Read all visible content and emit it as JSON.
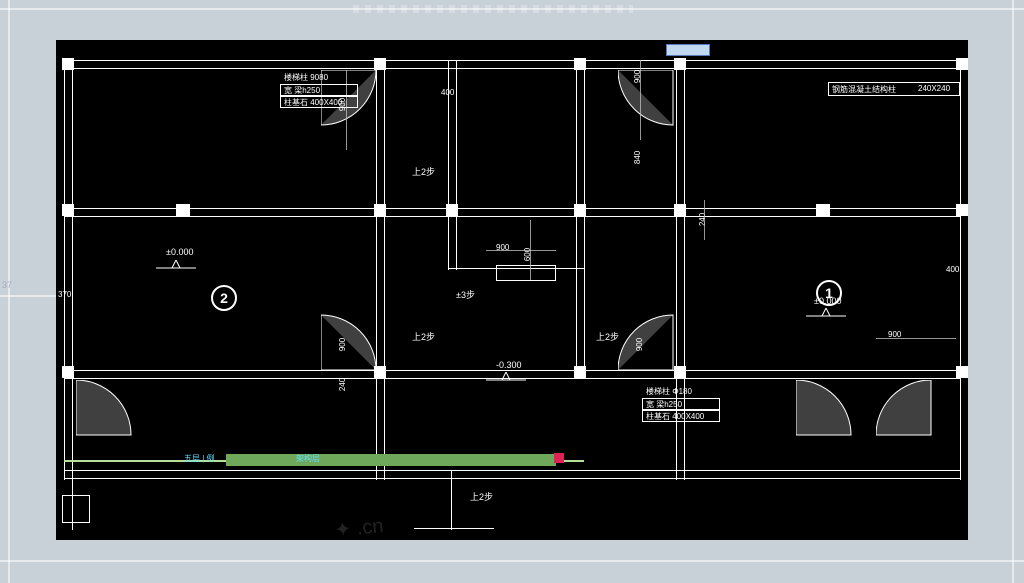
{
  "drawing": {
    "room_markers": {
      "left": "2",
      "right": "1"
    },
    "elevations": {
      "zero_left": "±0.000",
      "zero_right": "±0.000",
      "neg": "-0.300",
      "stair_a": "±3步",
      "stair_b": "上2步",
      "stair_c": "上2步",
      "stair_d": "上2步",
      "stair_e": "上2步"
    },
    "dimensions": {
      "d370": "370",
      "d400a": "400",
      "d400b": "400",
      "d900a": "900",
      "d900b": "900",
      "d900c": "900",
      "d900d": "900",
      "d900e": "900",
      "d900f": "900",
      "d840": "840",
      "d600": "600",
      "d240a": "240",
      "d240b": "240"
    },
    "notes": {
      "col_note_title1": "楼梯柱  9080",
      "col_note_line1": "宽   梁h250",
      "col_note_line2": "柱基石  400X400",
      "col_note_title2": "楼梯柱  Φ180",
      "col_note_line2a": "宽   梁h250",
      "col_note_line2b": "柱基石  400X400",
      "note_right": "钢筋混凝土结构柱",
      "note_right_dim": "240X240"
    },
    "toolbar": {
      "label1": "五层 | 例",
      "label2": "架构层"
    },
    "outside_label": "37"
  }
}
